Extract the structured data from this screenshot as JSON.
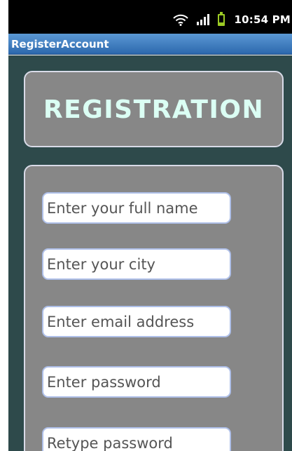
{
  "status_bar": {
    "time": "10:54 PM",
    "icons": [
      "wifi-icon",
      "signal-icon",
      "battery-icon"
    ],
    "battery_color": "#9ccb24"
  },
  "title_bar": {
    "title": "RegisterAccount"
  },
  "header": {
    "heading": "REGISTRATION"
  },
  "form": {
    "fields": [
      {
        "placeholder": "Enter your full name"
      },
      {
        "placeholder": "Enter your city"
      },
      {
        "placeholder": "Enter email address"
      },
      {
        "placeholder": "Enter password"
      },
      {
        "placeholder": "Retype password"
      }
    ]
  },
  "colors": {
    "background": "#2e4a4b",
    "card": "#878787",
    "heading": "#dbfff4",
    "title_bar": "#3b7ac0"
  }
}
